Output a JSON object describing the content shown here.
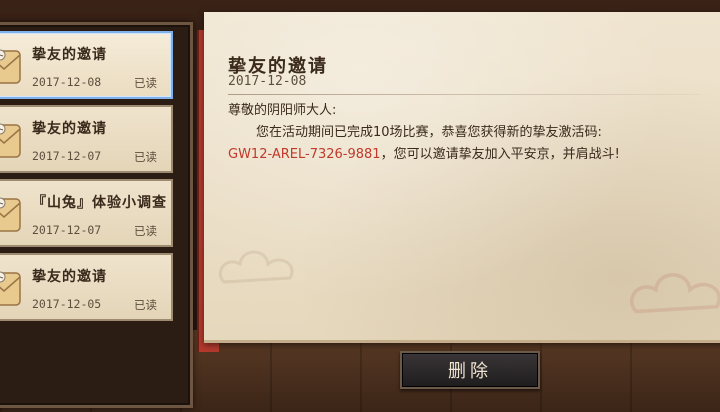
{
  "mail_list": [
    {
      "title": "挚友的邀请",
      "date": "2017-12-08",
      "status": "已读",
      "selected": true
    },
    {
      "title": "挚友的邀请",
      "date": "2017-12-07",
      "status": "已读",
      "selected": false
    },
    {
      "title": "『山兔』体验小调查",
      "date": "2017-12-07",
      "status": "已读",
      "selected": false
    },
    {
      "title": "挚友的邀请",
      "date": "2017-12-05",
      "status": "已读",
      "selected": false
    }
  ],
  "detail": {
    "title": "挚友的邀请",
    "date": "2017-12-08",
    "greeting": "尊敬的阴阳师大人:",
    "line1": "您在活动期间已完成10场比赛，恭喜您获得新的挚友激活码:",
    "code": "GW12-AREL-7326-9881",
    "line2": "，您可以邀请挚友加入平安京，并肩战斗!"
  },
  "actions": {
    "delete_label": "删除"
  },
  "colors": {
    "code": "#c0392b",
    "selected_border": "#7fb1e8"
  }
}
